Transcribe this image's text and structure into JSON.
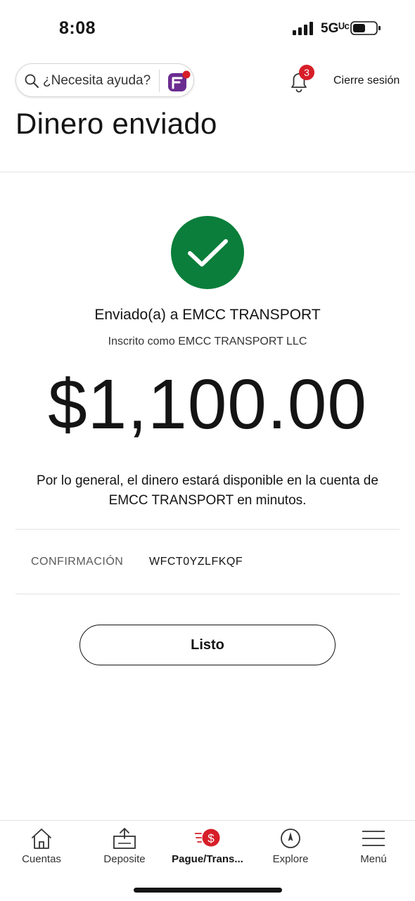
{
  "status_bar": {
    "time": "8:08",
    "network": "5Gᵁᶜ"
  },
  "header": {
    "help_placeholder": "¿Necesita ayuda?",
    "notification_count": "3",
    "logout_label": "Cierre sesión"
  },
  "page": {
    "title": "Dinero enviado"
  },
  "confirmation_view": {
    "sent_to": "Enviado(a) a EMCC TRANSPORT",
    "registered_as": "Inscrito como EMCC TRANSPORT LLC",
    "amount": "$1,100.00",
    "availability_note": "Por lo general, el dinero estará disponible en la cuenta de EMCC TRANSPORT en minutos.",
    "confirmation_label": "CONFIRMACIÓN",
    "confirmation_number": "WFCT0YZLFKQF",
    "done_label": "Listo"
  },
  "tab_bar": {
    "items": [
      {
        "label": "Cuentas",
        "icon": "home-icon"
      },
      {
        "label": "Deposite",
        "icon": "deposit-icon"
      },
      {
        "label": "Pague/Trans...",
        "icon": "pay-transfer-icon",
        "active": true
      },
      {
        "label": "Explore",
        "icon": "compass-icon"
      },
      {
        "label": "Menú",
        "icon": "menu-icon"
      }
    ]
  },
  "colors": {
    "success_green": "#0a7e3a",
    "brand_red": "#d71e28",
    "fargo_purple": "#6b2c91",
    "text_primary": "#141414",
    "divider": "#e3e3e3"
  }
}
